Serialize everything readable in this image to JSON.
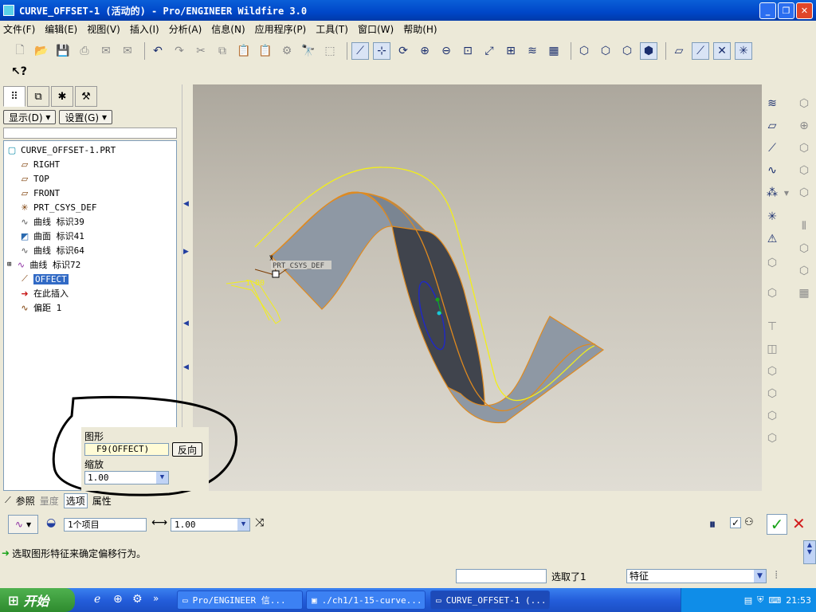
{
  "window": {
    "title": "CURVE_OFFSET-1 (活动的) - Pro/ENGINEER Wildfire 3.0"
  },
  "menubar": [
    "文件(F)",
    "编辑(E)",
    "视图(V)",
    "插入(I)",
    "分析(A)",
    "信息(N)",
    "应用程序(P)",
    "工具(T)",
    "窗口(W)",
    "帮助(H)"
  ],
  "panel": {
    "show_label": "显示(D)",
    "settings_label": "设置(G)"
  },
  "tree": [
    {
      "icon": "part-icon",
      "glyph": "▢",
      "label": "CURVE_OFFSET-1.PRT"
    },
    {
      "icon": "datum-plane-icon",
      "glyph": "▱",
      "label": "RIGHT"
    },
    {
      "icon": "datum-plane-icon",
      "glyph": "▱",
      "label": "TOP"
    },
    {
      "icon": "datum-plane-icon",
      "glyph": "▱",
      "label": "FRONT"
    },
    {
      "icon": "csys-icon",
      "glyph": "✳",
      "label": "PRT_CSYS_DEF"
    },
    {
      "icon": "curve-icon",
      "glyph": "∿",
      "label": "曲线 标识39"
    },
    {
      "icon": "surface-icon",
      "glyph": "◩",
      "label": "曲面 标识41"
    },
    {
      "icon": "curve-icon",
      "glyph": "∿",
      "label": "曲线 标识64"
    },
    {
      "icon": "curve-icon",
      "glyph": "∿",
      "label": "曲线 标识72"
    },
    {
      "icon": "graph-icon",
      "glyph": "⟋",
      "label": "OFFECT"
    },
    {
      "icon": "insert-here-icon",
      "glyph": "➜",
      "label": "在此插入"
    },
    {
      "icon": "offset-icon",
      "glyph": "∿",
      "label": "偏距 1"
    }
  ],
  "viewport": {
    "csys_label": "PRT_CSYS_DEF",
    "axis_label": "y",
    "dim_value": "1.00"
  },
  "popup": {
    "graphic_label": "图形",
    "graphic_value": "F9(OFFECT)",
    "flip_label": "反向",
    "scale_label": "缩放",
    "scale_value": "1.00"
  },
  "dashboard": {
    "tabs": [
      "参照",
      "量度",
      "选项",
      "属性"
    ],
    "ref_value": "1个项目",
    "distance_value": "1.00"
  },
  "status": {
    "message": "选取图形特征来确定偏移行为。",
    "selected": "选取了1",
    "filter": "特征"
  },
  "taskbar": {
    "start": "开始",
    "tasks": [
      "Pro/ENGINEER 信...",
      "./ch1/1-15-curve...",
      "CURVE_OFFSET-1 (..."
    ],
    "time": "21:53"
  },
  "colors": {
    "selection": "#316ac5",
    "surface_edge": "#e08a1e",
    "curve": "#f2ee1a",
    "confirm": "#1aa31a",
    "cancel": "#d21b1b"
  }
}
